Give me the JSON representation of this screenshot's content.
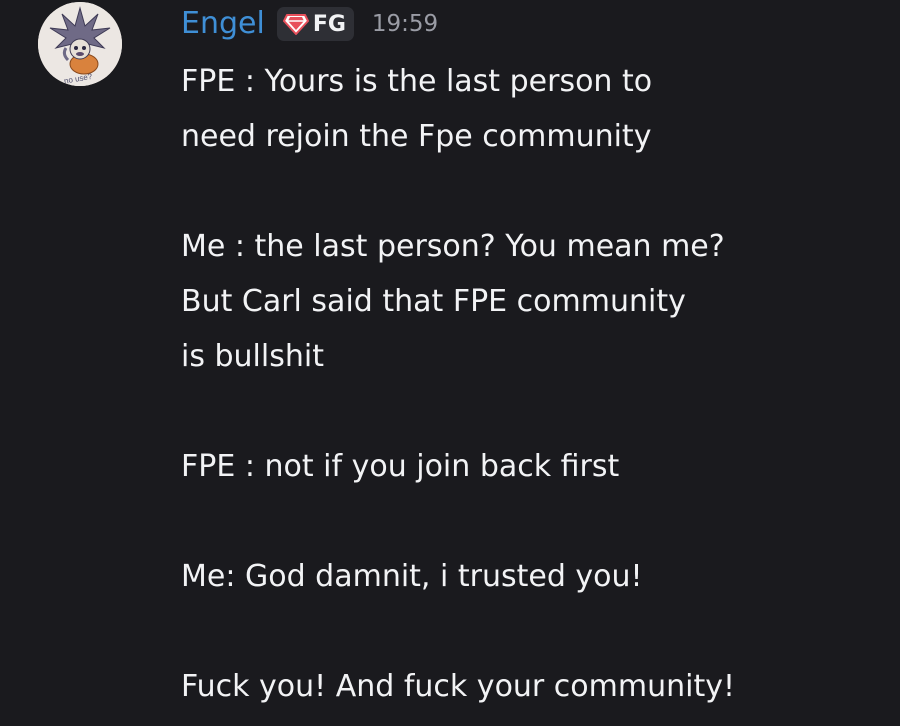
{
  "message": {
    "avatar": {
      "icon": "avatar-drawing-icon",
      "caption": "no use?"
    },
    "author": "Engel",
    "tag": {
      "icon": "gem-icon",
      "label": "FG",
      "icon_color": "#e8505b"
    },
    "timestamp": "19:59",
    "colors": {
      "username": "#3f8fd6",
      "text": "#f2f3f5",
      "timestamp": "#9a9ca5",
      "background": "#1a1a1e"
    },
    "lines": [
      "FPE : Yours is the last person to",
      "need rejoin the Fpe community",
      "",
      "Me : the last person? You mean me?",
      "But Carl said that FPE community",
      "is bullshit",
      "",
      "FPE : not if you join back first",
      "",
      "Me: God damnit, i trusted you!",
      "",
      "Fuck you! And fuck your community!"
    ]
  }
}
